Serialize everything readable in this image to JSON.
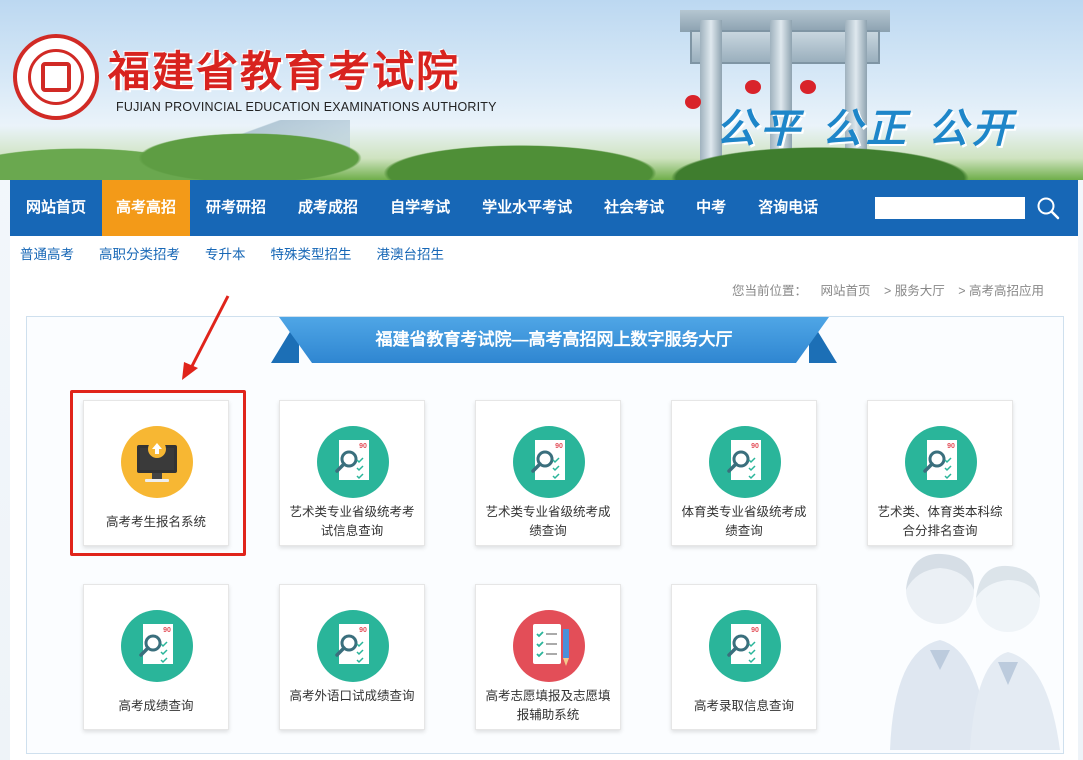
{
  "header": {
    "site_title": "福建省教育考试院",
    "site_subtitle": "FUJIAN PROVINCIAL EDUCATION EXAMINATIONS AUTHORITY",
    "slogan": "公平 公正 公开"
  },
  "nav": {
    "items": [
      {
        "label": "网站首页",
        "active": false
      },
      {
        "label": "高考高招",
        "active": true
      },
      {
        "label": "研考研招",
        "active": false
      },
      {
        "label": "成考成招",
        "active": false
      },
      {
        "label": "自学考试",
        "active": false
      },
      {
        "label": "学业水平考试",
        "active": false
      },
      {
        "label": "社会考试",
        "active": false
      },
      {
        "label": "中考",
        "active": false
      },
      {
        "label": "咨询电话",
        "active": false
      }
    ],
    "search_value": "",
    "search_icon": "search-icon"
  },
  "subnav": {
    "items": [
      "普通高考",
      "高职分类招考",
      "专升本",
      "特殊类型招生",
      "港澳台招生"
    ]
  },
  "breadcrumb": {
    "prefix": "您当前位置：",
    "items": [
      "网站首页",
      "> 服务大厅",
      "> 高考高招应用"
    ]
  },
  "hall": {
    "title": "福建省教育考试院—高考高招网上数字服务大厅",
    "cards": [
      {
        "label": "高考考生报名系统",
        "icon": "monitor-upload-icon",
        "color": "#f7b733"
      },
      {
        "label": "艺术类专业省级统考考试信息查询",
        "icon": "score-sheet-icon",
        "color": "#2ab59a"
      },
      {
        "label": "艺术类专业省级统考成绩查询",
        "icon": "score-sheet-icon",
        "color": "#2ab59a"
      },
      {
        "label": "体育类专业省级统考成绩查询",
        "icon": "score-sheet-icon",
        "color": "#2ab59a"
      },
      {
        "label": "艺术类、体育类本科综合分排名查询",
        "icon": "score-sheet-icon",
        "color": "#2ab59a"
      },
      {
        "label": "高考成绩查询",
        "icon": "score-sheet-icon",
        "color": "#2ab59a"
      },
      {
        "label": "高考外语口试成绩查询",
        "icon": "score-sheet-icon",
        "color": "#2ab59a"
      },
      {
        "label": "高考志愿填报及志愿填报辅助系统",
        "icon": "checklist-pencil-icon",
        "color": "#e34e58"
      },
      {
        "label": "高考录取信息查询",
        "icon": "score-sheet-icon",
        "color": "#2ab59a"
      }
    ],
    "score_badge": "90"
  },
  "colors": {
    "nav_bg": "#1767b6",
    "nav_active": "#f39a18",
    "title_red": "#d8231f",
    "highlight": "#e0241b"
  }
}
